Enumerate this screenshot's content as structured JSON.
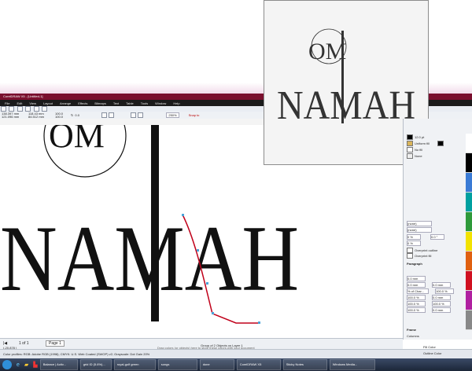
{
  "window": {
    "title": "CorelDRAW X5 - [Untitled-1]"
  },
  "menu": [
    "File",
    "Edit",
    "View",
    "Layout",
    "Arrange",
    "Effects",
    "Bitmaps",
    "Text",
    "Table",
    "Tools",
    "Window",
    "Help"
  ],
  "propbar": {
    "x": "138.397 mm",
    "y": "121.096 mm",
    "w": "118.43 mm",
    "h": "84.512 mm",
    "sx": "100.0",
    "sy": "100.0",
    "angle": "0.0",
    "zoom": "250%",
    "snap": "Snap to"
  },
  "artwork": {
    "line1": "OM",
    "line2": "NAMAH",
    "preview_line1": "OM",
    "preview_line2": "NAMAH"
  },
  "docker": {
    "section_fill": "Fill",
    "fill_type": "Uniform fill",
    "fill_none": "No fill",
    "outline_width": "12.0 pt",
    "outline_none": "None",
    "combo_none1": "(none)",
    "combo_none2": "(none)",
    "spacing1": "0 %",
    "spacing2": "0.0 °",
    "spacing3": "0 %",
    "overprint_outline": "Overprint outline",
    "overprint_fill": "Overprint fill",
    "paragraph": "Paragraph",
    "p1": "0.0 mm",
    "p2": "0.0 mm",
    "p3": "0.0 mm",
    "p4": "0.0 mm",
    "p5": "0.0 mm",
    "pct_of_char": "% of Char...",
    "p6": "100.0 %",
    "p7": "100.0 %",
    "p8": "100.0 %",
    "p9": "100.0 %",
    "p10": "100.0 %",
    "frame": "Frame",
    "columns": "Columns"
  },
  "status": {
    "pages": "1 of 1",
    "page_tab": "Page 1",
    "coords": "(-20.878 )",
    "hint": "Drag colors (or objects) here to store these colors with your document",
    "selection": "Group of 2 Objects on Layer 1",
    "profiles": "Color profiles: RGB: Adobe RGB (1998); CMYK: U.S. Web Coated (SWOP) v2; Grayscale: Dot Gain 20%",
    "fill_color": "Fill Color",
    "outline_color": "Outline Color"
  },
  "taskbar": [
    "Balance | Activ...",
    "grid ID (5.6%)...",
    "royal-golf green",
    "songs",
    "done",
    "CorelDRAW X5",
    "Sticky Notes",
    "Windows Media..."
  ],
  "colors": {
    "titlebar": "#7a0f2e",
    "ink": "#111111",
    "accent_red": "#c0001a"
  }
}
